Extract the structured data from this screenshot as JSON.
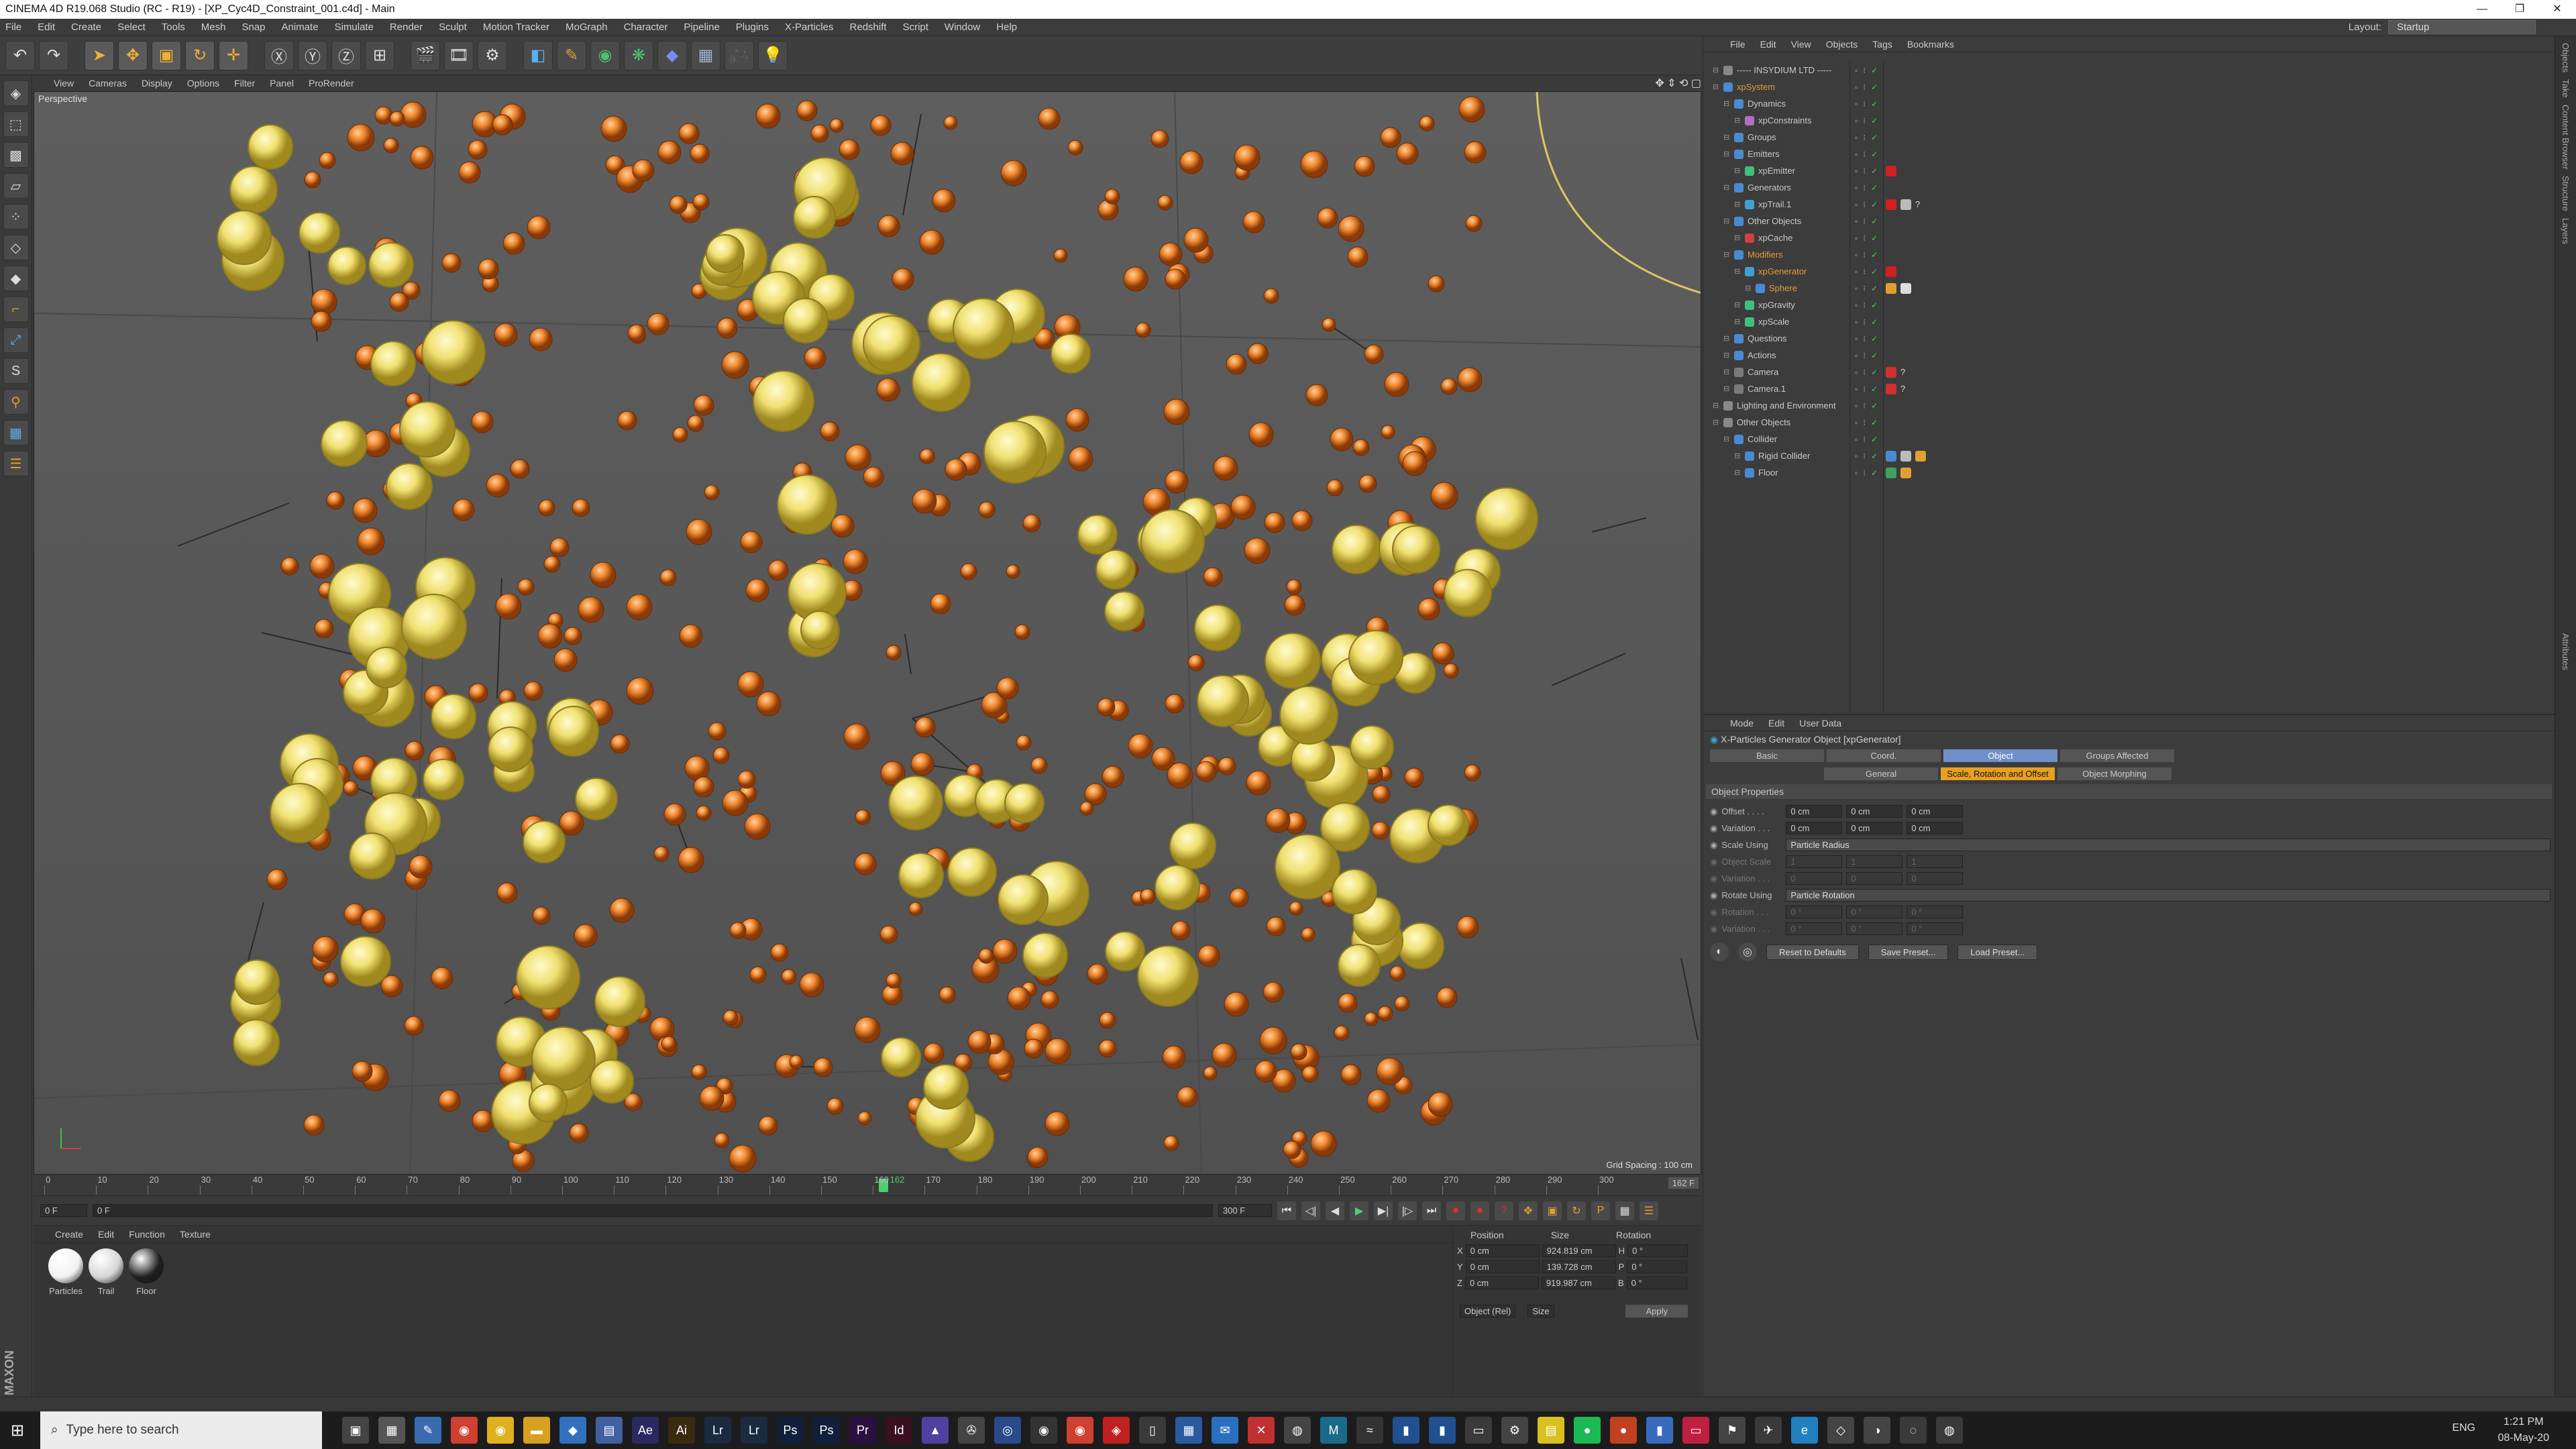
{
  "window": {
    "title": "CINEMA 4D R19.068 Studio (RC - R19) - [XP_Cyc4D_Constraint_001.c4d] - Main"
  },
  "menubar": [
    "File",
    "Edit",
    "Create",
    "Select",
    "Tools",
    "Mesh",
    "Snap",
    "Animate",
    "Simulate",
    "Render",
    "Sculpt",
    "Motion Tracker",
    "MoGraph",
    "Character",
    "Pipeline",
    "Plugins",
    "X-Particles",
    "Redshift",
    "Script",
    "Window",
    "Help"
  ],
  "layout": {
    "label": "Layout:",
    "value": "Startup"
  },
  "viewport": {
    "menu": [
      "View",
      "Cameras",
      "Display",
      "Options",
      "Filter",
      "Panel",
      "ProRender"
    ],
    "label": "Perspective",
    "grid_spacing": "Grid Spacing : 100 cm"
  },
  "timeline": {
    "ticks": [
      "0",
      "10",
      "20",
      "30",
      "40",
      "50",
      "60",
      "70",
      "80",
      "90",
      "100",
      "110",
      "120",
      "130",
      "140",
      "150",
      "160",
      "170",
      "180",
      "190",
      "200",
      "210",
      "220",
      "230",
      "240",
      "250",
      "260",
      "270",
      "280",
      "290",
      "300"
    ],
    "current": "162",
    "end": "162 F"
  },
  "transport": {
    "start": "0 F",
    "current": "0 F",
    "end_field": "300 F",
    "max": "300 F"
  },
  "materials": {
    "menu": [
      "Create",
      "Edit",
      "Function",
      "Texture"
    ],
    "items": [
      {
        "name": "Particles",
        "color": "#f2f2f2"
      },
      {
        "name": "Trail",
        "color": "#d6d6d6"
      },
      {
        "name": "Floor",
        "color": "#202020"
      }
    ]
  },
  "coords": {
    "headers": [
      "Position",
      "Size",
      "Rotation"
    ],
    "rows": [
      {
        "axis": "X",
        "pos": "0 cm",
        "size": "924.819 cm",
        "rlabel": "H",
        "rot": "0 °"
      },
      {
        "axis": "Y",
        "pos": "0 cm",
        "size": "139.728 cm",
        "rlabel": "P",
        "rot": "0 °"
      },
      {
        "axis": "Z",
        "pos": "0 cm",
        "size": "919.987 cm",
        "rlabel": "B",
        "rot": "0 °"
      }
    ],
    "mode": "Object (Rel)",
    "size_mode": "Size",
    "apply": "Apply"
  },
  "objects": {
    "menu": [
      "File",
      "Edit",
      "View",
      "Objects",
      "Tags",
      "Bookmarks"
    ],
    "tree": [
      {
        "indent": 0,
        "name": "----- INSYDIUM LTD -----",
        "color": "#c8c8c8",
        "icon": "#888888",
        "tags": []
      },
      {
        "indent": 0,
        "name": "xpSystem",
        "color": "#e89a3a",
        "icon": "#4a8ad0",
        "tags": []
      },
      {
        "indent": 1,
        "name": "Dynamics",
        "color": "#c8c8c8",
        "icon": "#4a8ad0",
        "tags": []
      },
      {
        "indent": 2,
        "name": "xpConstraints",
        "color": "#c8c8c8",
        "icon": "#b070c0",
        "tags": []
      },
      {
        "indent": 1,
        "name": "Groups",
        "color": "#c8c8c8",
        "icon": "#4a8ad0",
        "tags": []
      },
      {
        "indent": 1,
        "name": "Emitters",
        "color": "#c8c8c8",
        "icon": "#4a8ad0",
        "tags": []
      },
      {
        "indent": 2,
        "name": "xpEmitter",
        "color": "#c8c8c8",
        "icon": "#40c080",
        "tags": [
          "#d02020"
        ]
      },
      {
        "indent": 1,
        "name": "Generators",
        "color": "#c8c8c8",
        "icon": "#4a8ad0",
        "tags": []
      },
      {
        "indent": 2,
        "name": "xpTrail.1",
        "color": "#c8c8c8",
        "icon": "#40a0d0",
        "tags": [
          "#d02020",
          "#bbbbbb",
          "?"
        ]
      },
      {
        "indent": 1,
        "name": "Other Objects",
        "color": "#c8c8c8",
        "icon": "#4a8ad0",
        "tags": []
      },
      {
        "indent": 2,
        "name": "xpCache",
        "color": "#c8c8c8",
        "icon": "#d04040",
        "tags": []
      },
      {
        "indent": 1,
        "name": "Modifiers",
        "color": "#e89a3a",
        "icon": "#4a8ad0",
        "tags": []
      },
      {
        "indent": 2,
        "name": "xpGenerator",
        "color": "#e89a3a",
        "icon": "#40a0d0",
        "tags": [
          "#d02020"
        ]
      },
      {
        "indent": 3,
        "name": "Sphere",
        "color": "#e89a3a",
        "icon": "#4a8ad0",
        "tags": [
          "#e0a030",
          "#dddddd"
        ]
      },
      {
        "indent": 2,
        "name": "xpGravity",
        "color": "#c8c8c8",
        "icon": "#40c080",
        "tags": []
      },
      {
        "indent": 2,
        "name": "xpScale",
        "color": "#c8c8c8",
        "icon": "#40c080",
        "tags": []
      },
      {
        "indent": 1,
        "name": "Questions",
        "color": "#c8c8c8",
        "icon": "#4a8ad0",
        "tags": []
      },
      {
        "indent": 1,
        "name": "Actions",
        "color": "#c8c8c8",
        "icon": "#4a8ad0",
        "tags": []
      },
      {
        "indent": 1,
        "name": "Camera",
        "color": "#c8c8c8",
        "icon": "#7a7a7a",
        "tags": [
          "#d03030",
          "?"
        ]
      },
      {
        "indent": 1,
        "name": "Camera.1",
        "color": "#c8c8c8",
        "icon": "#7a7a7a",
        "tags": [
          "#d03030",
          "?"
        ]
      },
      {
        "indent": 0,
        "name": "Lighting and Environment",
        "color": "#c8c8c8",
        "icon": "#888888",
        "tags": []
      },
      {
        "indent": 0,
        "name": "Other Objects",
        "color": "#c8c8c8",
        "icon": "#888888",
        "tags": []
      },
      {
        "indent": 1,
        "name": "Collider",
        "color": "#c8c8c8",
        "icon": "#4a8ad0",
        "tags": []
      },
      {
        "indent": 2,
        "name": "Rigid Collider",
        "color": "#c8c8c8",
        "icon": "#4a8ad0",
        "tags": [
          "#4a8ad0",
          "#bbbbbb",
          "#e0a030"
        ]
      },
      {
        "indent": 2,
        "name": "Floor",
        "color": "#c8c8c8",
        "icon": "#4a8ad0",
        "tags": [
          "#40a060",
          "#e0a030"
        ]
      }
    ]
  },
  "attributes": {
    "menu": [
      "Mode",
      "Edit",
      "User Data"
    ],
    "title": "X-Particles Generator Object [xpGenerator]",
    "tabs": [
      "Basic",
      "Coord.",
      "Object",
      "Groups Affected"
    ],
    "active_tab": "Object",
    "subtabs": [
      "General",
      "Scale, Rotation and Offset",
      "Object Morphing"
    ],
    "active_subtab": "Scale, Rotation and Offset",
    "section": "Object Properties",
    "rows": [
      {
        "label": "Offset . . . .",
        "values": [
          "0 cm",
          "0 cm",
          "0 cm"
        ],
        "dim": false
      },
      {
        "label": "Variation . . .",
        "values": [
          "0 cm",
          "0 cm",
          "0 cm"
        ],
        "dim": false
      }
    ],
    "scale_using": {
      "label": "Scale Using",
      "value": "Particle Radius"
    },
    "dim_rows1": [
      {
        "label": "Object Scale",
        "values": [
          "1",
          "1",
          "1"
        ]
      },
      {
        "label": "Variation . . .",
        "values": [
          "0",
          "0",
          "0"
        ]
      }
    ],
    "rotate_using": {
      "label": "Rotate Using",
      "value": "Particle Rotation"
    },
    "dim_rows2": [
      {
        "label": "Rotation . . .",
        "values": [
          "0 °",
          "0 °",
          "0 °"
        ]
      },
      {
        "label": "Variation . . .",
        "values": [
          "0 °",
          "0 °",
          "0 °"
        ]
      }
    ],
    "buttons": [
      "Reset to Defaults",
      "Save Preset...",
      "Load Preset..."
    ]
  },
  "right_strip": [
    "Objects",
    "Take",
    "Content Browser",
    "Structure",
    "Layers"
  ],
  "attr_strip": [
    "Attributes"
  ],
  "taskbar": {
    "search_placeholder": "Type here to search",
    "apps": [
      {
        "name": "task-view",
        "color": "#444",
        "glyph": "▣"
      },
      {
        "name": "calculator",
        "color": "#555",
        "glyph": "▦"
      },
      {
        "name": "paint",
        "color": "#3a6ab0",
        "glyph": "✎"
      },
      {
        "name": "chrome-1",
        "color": "#d04030",
        "glyph": "◉"
      },
      {
        "name": "chrome-2",
        "color": "#e0b020",
        "glyph": "◉"
      },
      {
        "name": "file-explorer",
        "color": "#d8a020",
        "glyph": "▬"
      },
      {
        "name": "app-blue",
        "color": "#3070c0",
        "glyph": "◆"
      },
      {
        "name": "store",
        "color": "#4060a0",
        "glyph": "▤"
      },
      {
        "name": "adobe-after-effects",
        "color": "#2a2a60",
        "glyph": "Ae"
      },
      {
        "name": "adobe-illustrator",
        "color": "#3a2a10",
        "glyph": "Ai"
      },
      {
        "name": "lightroom",
        "color": "#1a2a40",
        "glyph": "Lr"
      },
      {
        "name": "lightroom-classic",
        "color": "#1a2a40",
        "glyph": "Lr"
      },
      {
        "name": "photoshop",
        "color": "#10203a",
        "glyph": "Ps"
      },
      {
        "name": "photoshop-2",
        "color": "#10203a",
        "glyph": "Ps"
      },
      {
        "name": "premiere",
        "color": "#2a1040",
        "glyph": "Pr"
      },
      {
        "name": "indesign",
        "color": "#3a1020",
        "glyph": "Id"
      },
      {
        "name": "app-purple",
        "color": "#5040a0",
        "glyph": "▲"
      },
      {
        "name": "davinci",
        "color": "#444",
        "glyph": "✇"
      },
      {
        "name": "cinema4d",
        "color": "#2a4a8a",
        "glyph": "◎"
      },
      {
        "name": "obs",
        "color": "#333",
        "glyph": "◉"
      },
      {
        "name": "chrome-3",
        "color": "#d04030",
        "glyph": "◉"
      },
      {
        "name": "app-red",
        "color": "#c02020",
        "glyph": "◈"
      },
      {
        "name": "document",
        "color": "#3a3a3a",
        "glyph": "▯"
      },
      {
        "name": "calendar",
        "color": "#2a5aa0",
        "glyph": "▦"
      },
      {
        "name": "mail",
        "color": "#2a70c0",
        "glyph": "✉"
      },
      {
        "name": "app-x",
        "color": "#c03030",
        "glyph": "✕"
      },
      {
        "name": "camera",
        "color": "#444",
        "glyph": "◍"
      },
      {
        "name": "maya",
        "color": "#1a6a8a",
        "glyph": "M"
      },
      {
        "name": "app-wave",
        "color": "#333",
        "glyph": "≈"
      },
      {
        "name": "app-b",
        "color": "#205090",
        "glyph": "▮"
      },
      {
        "name": "app-c",
        "color": "#205090",
        "glyph": "▮"
      },
      {
        "name": "app-d",
        "color": "#3a3a3a",
        "glyph": "▭"
      },
      {
        "name": "settings",
        "color": "#444",
        "glyph": "⚙"
      },
      {
        "name": "notes",
        "color": "#d8c020",
        "glyph": "▤"
      },
      {
        "name": "spotify",
        "color": "#1db954",
        "glyph": "●"
      },
      {
        "name": "app-e",
        "color": "#c04020",
        "glyph": "●"
      },
      {
        "name": "app-f",
        "color": "#3a6ac0",
        "glyph": "▮"
      },
      {
        "name": "app-g",
        "color": "#c02040",
        "glyph": "▭"
      },
      {
        "name": "app-h",
        "color": "#444",
        "glyph": "⚑"
      },
      {
        "name": "app-i",
        "color": "#3a3a3a",
        "glyph": "✈"
      },
      {
        "name": "edge",
        "color": "#2080c0",
        "glyph": "e"
      },
      {
        "name": "app-j",
        "color": "#444",
        "glyph": "◇"
      },
      {
        "name": "app-k",
        "color": "#444",
        "glyph": "◑"
      },
      {
        "name": "app-l",
        "color": "#3a3a3a",
        "glyph": "◌"
      },
      {
        "name": "app-m",
        "color": "#3a3a3a",
        "glyph": "◍"
      }
    ],
    "lang": "ENG",
    "time": "1:21 PM",
    "date": "08-May-20"
  }
}
